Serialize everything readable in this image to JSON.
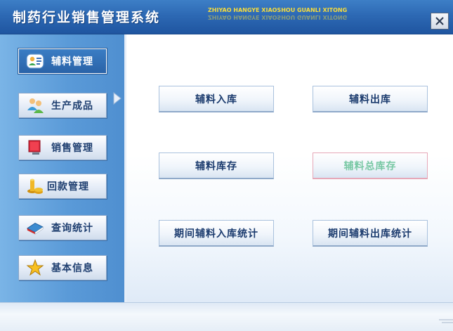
{
  "window": {
    "title": "制药行业销售管理系统",
    "subtitle": "ZHIYAO HANGYE XIAOSHOU GUANLI XITONG",
    "close_glyph": "✕"
  },
  "sidebar": {
    "items": [
      {
        "label": "辅料管理",
        "icon": "user-group-icon",
        "active": true
      },
      {
        "label": "生产成品",
        "icon": "people-icon",
        "active": false
      },
      {
        "label": "销售管理",
        "icon": "monitor-icon",
        "active": false
      },
      {
        "label": "回款管理",
        "icon": "coin-stack-icon",
        "active": false
      },
      {
        "label": "查询统计",
        "icon": "book-icon",
        "active": false
      },
      {
        "label": "基本信息",
        "icon": "star-icon",
        "active": false
      }
    ]
  },
  "main": {
    "buttons": [
      {
        "label": "辅料入库"
      },
      {
        "label": "辅料出库"
      },
      {
        "label": "辅料库存"
      },
      {
        "label": "辅料总库存",
        "disabled": true
      },
      {
        "label": "期间辅料入库统计"
      },
      {
        "label": "期间辅料出库统计"
      }
    ]
  },
  "colors": {
    "titlebar": "#2d69b4",
    "sidebar": "#5a9ad8",
    "accent_text": "#1b3b6e",
    "disabled_text": "#78c8a4",
    "subtitle": "#f7dc3c"
  }
}
